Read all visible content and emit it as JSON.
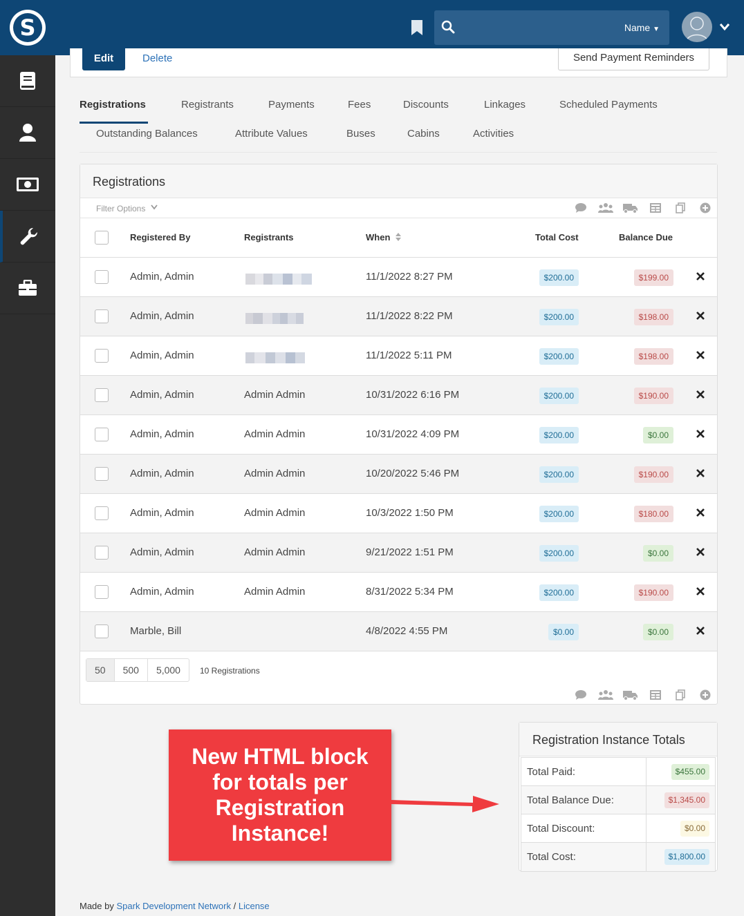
{
  "header": {
    "logo_letter": "S",
    "search_scope": "Name"
  },
  "toolbar": {
    "edit_label": "Edit",
    "delete_label": "Delete",
    "reminders_label": "Send Payment Reminders"
  },
  "tabs": [
    {
      "label": "Registrations",
      "active": true
    },
    {
      "label": "Registrants"
    },
    {
      "label": "Payments"
    },
    {
      "label": "Fees"
    },
    {
      "label": "Discounts"
    },
    {
      "label": "Linkages"
    },
    {
      "label": "Scheduled Payments"
    },
    {
      "label": "Outstanding Balances"
    },
    {
      "label": "Attribute Values"
    },
    {
      "label": "Buses"
    },
    {
      "label": "Cabins"
    },
    {
      "label": "Activities"
    }
  ],
  "grid": {
    "title": "Registrations",
    "filter_label": "Filter Options",
    "columns": {
      "registered_by": "Registered By",
      "registrants": "Registrants",
      "when": "When",
      "total_cost": "Total Cost",
      "balance_due": "Balance Due"
    },
    "rows": [
      {
        "registered_by": "Admin, Admin",
        "registrants": "",
        "when": "11/1/2022 8:27 PM",
        "total_cost": "$200.00",
        "balance_due": "$199.00",
        "balance_status": "red"
      },
      {
        "registered_by": "Admin, Admin",
        "registrants": "",
        "when": "11/1/2022 8:22 PM",
        "total_cost": "$200.00",
        "balance_due": "$198.00",
        "balance_status": "red"
      },
      {
        "registered_by": "Admin, Admin",
        "registrants": "",
        "when": "11/1/2022 5:11 PM",
        "total_cost": "$200.00",
        "balance_due": "$198.00",
        "balance_status": "red"
      },
      {
        "registered_by": "Admin, Admin",
        "registrants": "Admin Admin",
        "when": "10/31/2022 6:16 PM",
        "total_cost": "$200.00",
        "balance_due": "$190.00",
        "balance_status": "red"
      },
      {
        "registered_by": "Admin, Admin",
        "registrants": "Admin Admin",
        "when": "10/31/2022 4:09 PM",
        "total_cost": "$200.00",
        "balance_due": "$0.00",
        "balance_status": "green"
      },
      {
        "registered_by": "Admin, Admin",
        "registrants": "Admin Admin",
        "when": "10/20/2022 5:46 PM",
        "total_cost": "$200.00",
        "balance_due": "$190.00",
        "balance_status": "red"
      },
      {
        "registered_by": "Admin, Admin",
        "registrants": "Admin Admin",
        "when": "10/3/2022 1:50 PM",
        "total_cost": "$200.00",
        "balance_due": "$180.00",
        "balance_status": "red"
      },
      {
        "registered_by": "Admin, Admin",
        "registrants": "Admin Admin",
        "when": "9/21/2022 1:51 PM",
        "total_cost": "$200.00",
        "balance_due": "$0.00",
        "balance_status": "green"
      },
      {
        "registered_by": "Admin, Admin",
        "registrants": "Admin Admin",
        "when": "8/31/2022 5:34 PM",
        "total_cost": "$200.00",
        "balance_due": "$190.00",
        "balance_status": "red"
      },
      {
        "registered_by": "Marble, Bill",
        "registrants": "",
        "when": "4/8/2022 4:55 PM",
        "total_cost": "$0.00",
        "balance_due": "$0.00",
        "balance_status": "green"
      }
    ],
    "page_sizes": [
      "50",
      "500",
      "5,000"
    ],
    "count_label": "10 Registrations"
  },
  "callout": {
    "text": "New HTML block for totals per Registration Instance!"
  },
  "totals": {
    "title": "Registration Instance Totals",
    "rows": [
      {
        "label": "Total Paid:",
        "value": "$455.00",
        "status": "green"
      },
      {
        "label": "Total Balance Due:",
        "value": "$1,345.00",
        "status": "red"
      },
      {
        "label": "Total Discount:",
        "value": "$0.00",
        "status": "yellow"
      },
      {
        "label": "Total Cost:",
        "value": "$1,800.00",
        "status": "blue"
      }
    ]
  },
  "footer": {
    "made_by": "Made by",
    "org_link": "Spark Development Network",
    "separator": "/",
    "license_link": "License"
  },
  "colors": {
    "brand": "#0e4675",
    "sidebar": "#2e2e2e",
    "callout": "#ef3b3f"
  }
}
